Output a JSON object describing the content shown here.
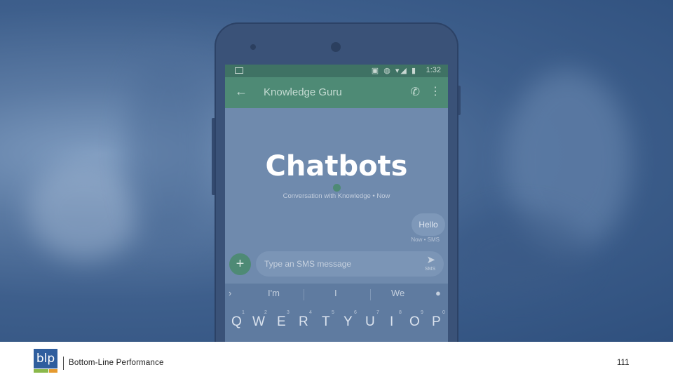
{
  "slide": {
    "title": "Chatbots"
  },
  "phone": {
    "status_time": "1:32",
    "app_title": "Knowledge Guru",
    "conversation_label": "Conversation with Knowledge • Now",
    "message_text": "Hello",
    "message_meta": "Now • SMS",
    "composer_placeholder": "Type an SMS message",
    "send_label": "SMS",
    "suggestions": [
      "I'm",
      "I",
      "We"
    ],
    "keys": [
      "Q",
      "W",
      "E",
      "R",
      "T",
      "Y",
      "U",
      "I",
      "O",
      "P"
    ],
    "key_numbers": [
      "1",
      "2",
      "3",
      "4",
      "5",
      "6",
      "7",
      "8",
      "9",
      "0"
    ]
  },
  "footer": {
    "logo_text": "blp",
    "company": "Bottom-Line  Performance",
    "page_number": "111"
  },
  "colors": {
    "overlay": "#2f507e",
    "accent_green": "#4e8a75",
    "logo_blue": "#2f5e9e",
    "logo_green": "#8ab84a",
    "logo_orange": "#e59a2e"
  },
  "icons": [
    "back-arrow-icon",
    "phone-icon",
    "more-vert-icon",
    "plus-icon",
    "send-icon",
    "mic-icon",
    "chevron-right-icon"
  ]
}
